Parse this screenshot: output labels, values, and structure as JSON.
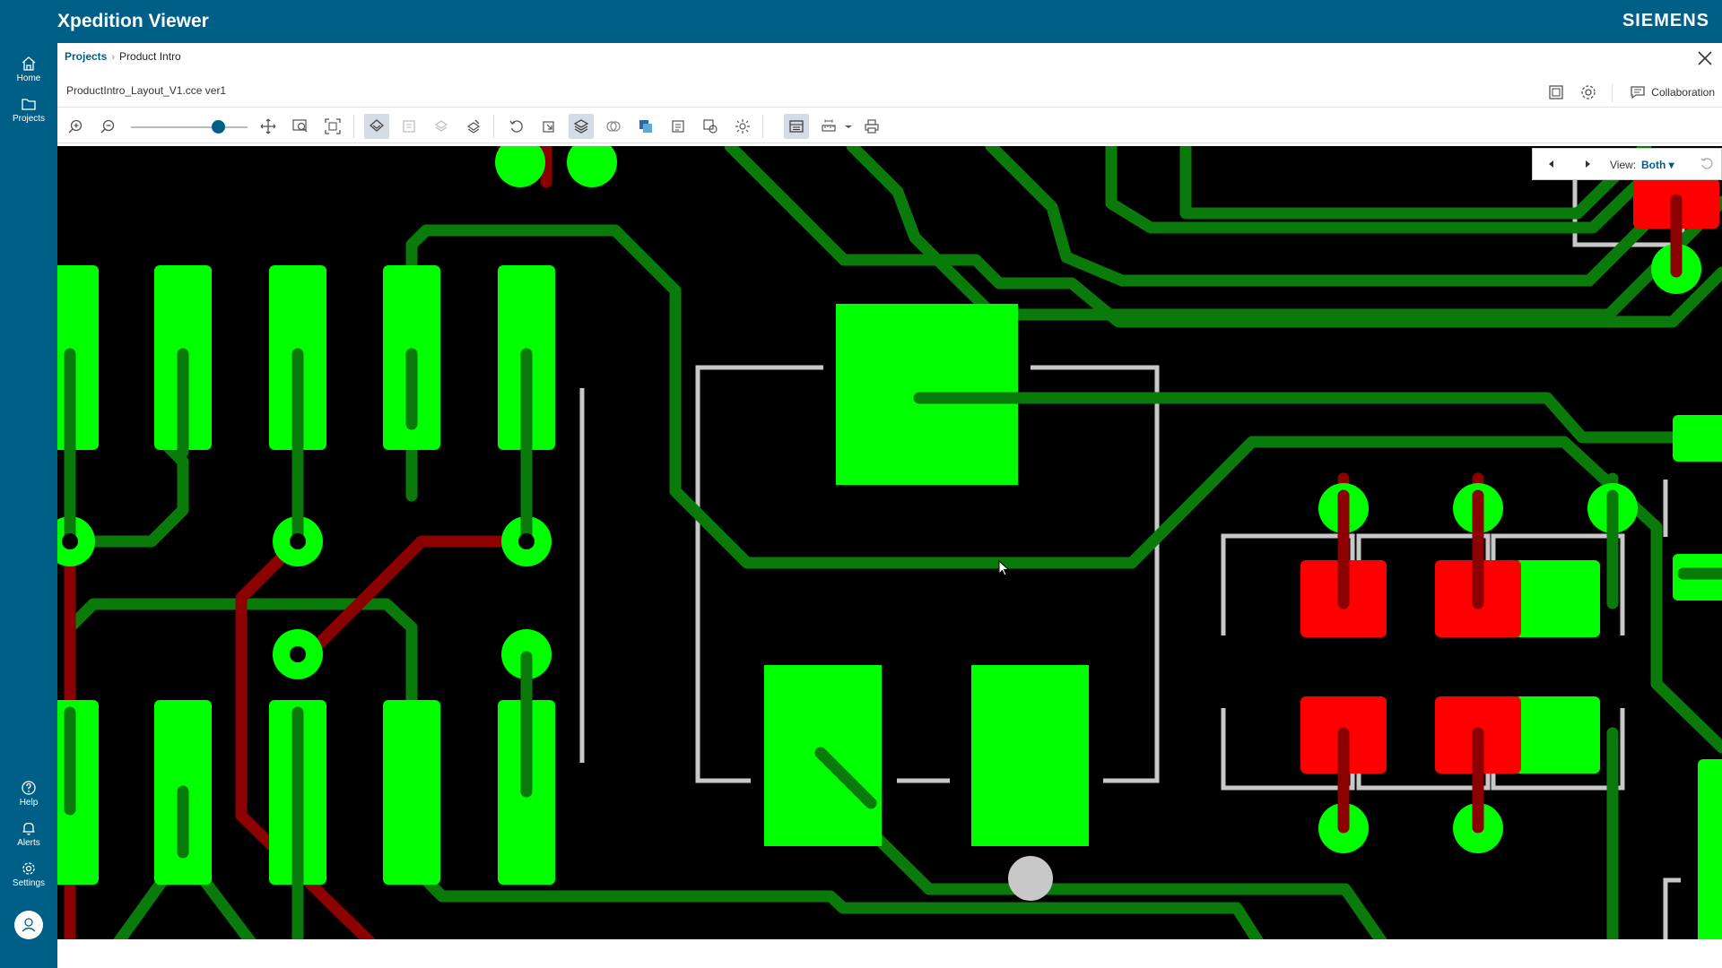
{
  "app": {
    "title": "Xpedition Viewer",
    "brand": "SIEMENS"
  },
  "sidebar": {
    "items": [
      {
        "label": "Home",
        "icon": "home-icon"
      },
      {
        "label": "Projects",
        "icon": "folder-icon"
      },
      {
        "label": "Help",
        "icon": "help-icon"
      },
      {
        "label": "Alerts",
        "icon": "bell-icon"
      },
      {
        "label": "Settings",
        "icon": "gear-icon"
      }
    ],
    "avatar_icon": "user-icon"
  },
  "breadcrumb": {
    "root": "Projects",
    "current": "Product Intro"
  },
  "document": {
    "file_name": "ProductIntro_Layout_V1.cce ver1"
  },
  "header": {
    "collaboration_label": "Collaboration"
  },
  "toolbar": {
    "zoom_level_fraction": 0.75,
    "buttons": [
      "zoom-in-icon",
      "zoom-out-icon",
      "pan-icon",
      "zoom-area-icon",
      "fit-view-icon",
      "layers-icon",
      "sheet-icon",
      "layer-stack-icon",
      "layer-edit-icon",
      "rotate-icon",
      "select-icon",
      "display-layers-icon",
      "net-icon",
      "overlay-icon",
      "component-icon",
      "highlight-icon",
      "brightness-icon",
      "properties-icon",
      "measure-icon",
      "print-icon"
    ]
  },
  "view_panel": {
    "label": "View:",
    "value": "Both"
  },
  "colors": {
    "brand": "#005f87",
    "pcb_background": "#000000",
    "pad_green": "#00ff00",
    "trace_green": "#0a7a0a",
    "trace_red": "#8b0000",
    "pad_red": "#ff0000",
    "silkscreen": "#c8c8c8"
  }
}
